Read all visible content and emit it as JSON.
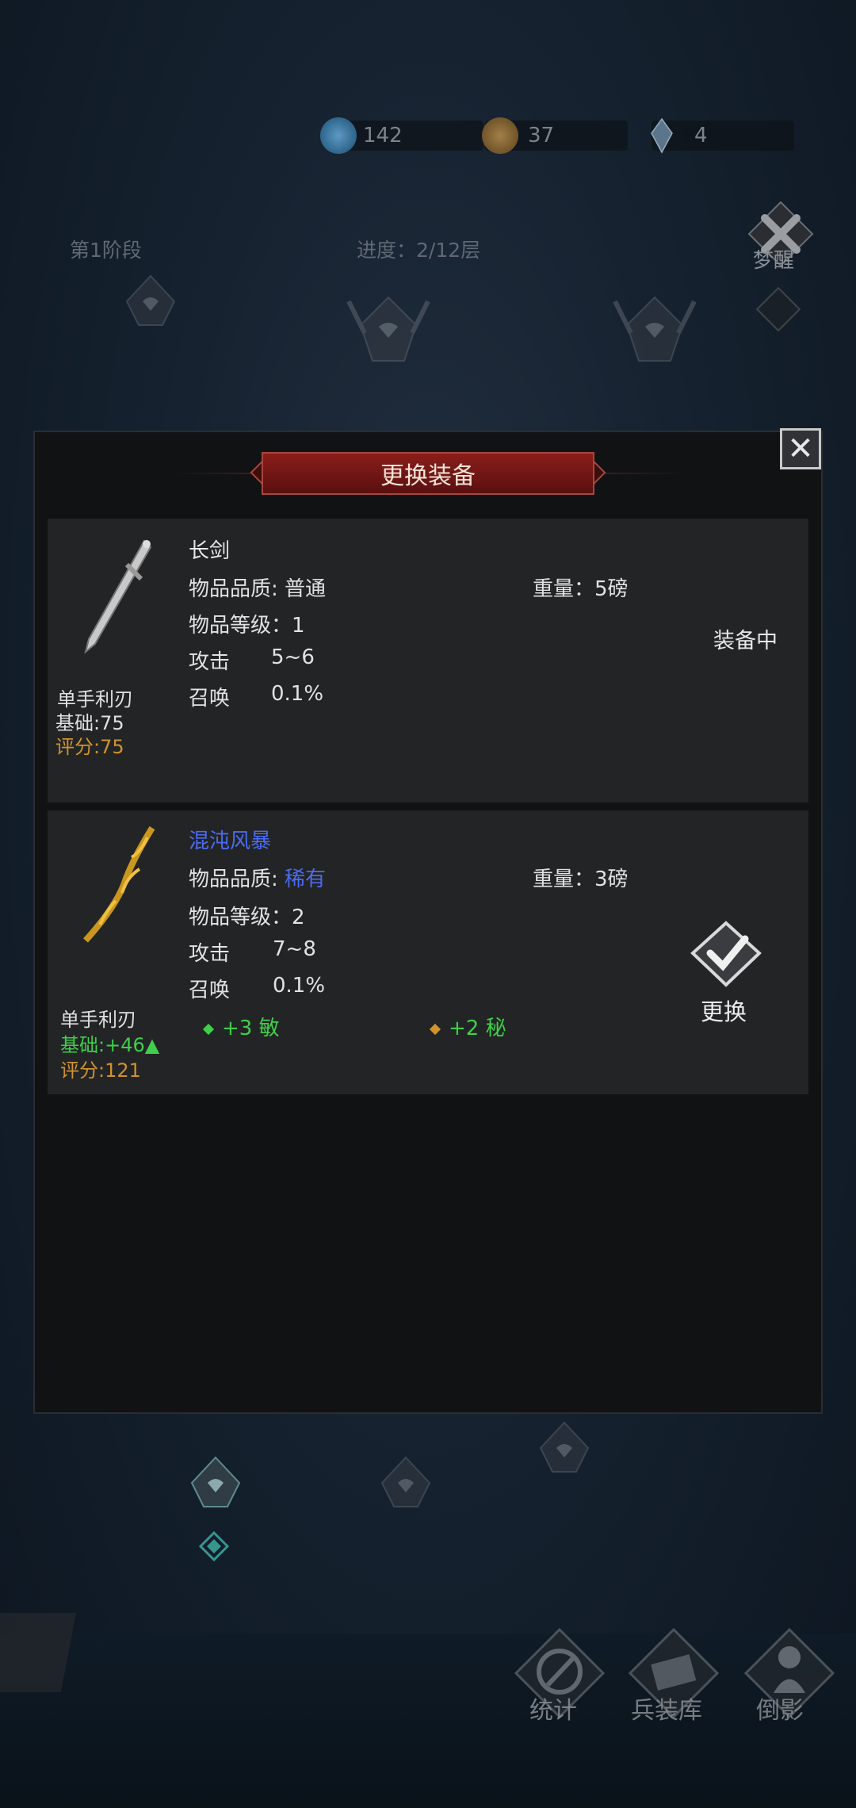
{
  "resources": [
    {
      "icon": "soul-orb-icon",
      "value": "142"
    },
    {
      "icon": "coin-icon",
      "value": "37"
    },
    {
      "icon": "crystal-icon",
      "value": "4"
    }
  ],
  "stage": {
    "label": "第1阶段",
    "progress": "进度：2/12层"
  },
  "wake_label": "梦醒",
  "modal": {
    "title": "更换装备",
    "close_icon": "close-icon",
    "current": {
      "name": "长剑",
      "name_color": "#e8e8e8",
      "quality_label": "物品品质: ",
      "quality_value": "普通",
      "weight": "重量：5磅",
      "level": "物品等级：1",
      "attack_label": "攻击",
      "attack_value": "5~6",
      "summon_label": "召唤",
      "summon_value": "0.1%",
      "type": "单手利刃",
      "base": "基础:75",
      "score": "评分:75",
      "status": "装备中"
    },
    "candidate": {
      "name": "混沌风暴",
      "name_color": "#4b6cf0",
      "quality_label": "物品品质: ",
      "quality_value": "稀有",
      "quality_color": "#4b6cf0",
      "weight": "重量：3磅",
      "level": "物品等级：2",
      "attack_label": "攻击",
      "attack_value": "7~8",
      "summon_label": "召唤",
      "summon_value": "0.1%",
      "type": "单手利刃",
      "base": "基础:+46▲",
      "score": "评分:121",
      "bonus1": "+3 敏",
      "bonus2": "+2 秘",
      "action": "更换"
    }
  },
  "nav": [
    {
      "label": "统计",
      "icon": "stats-icon"
    },
    {
      "label": "兵装库",
      "icon": "armory-icon"
    },
    {
      "label": "倒影",
      "icon": "reflection-icon"
    }
  ],
  "colors": {
    "accent_red": "#7a1a17",
    "bonus_green": "#3fcf4b",
    "score_gold": "#d0932d",
    "rare_blue": "#4b6cf0"
  }
}
